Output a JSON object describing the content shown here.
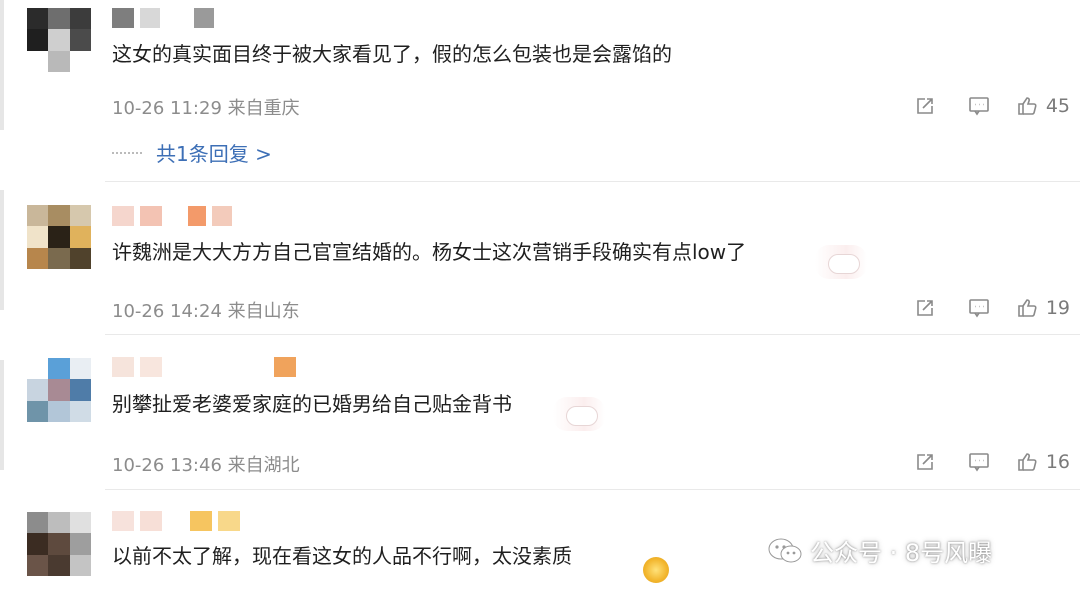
{
  "comments": [
    {
      "text": "这女的真实面目终于被大家看见了，假的怎么包装也是会露馅的",
      "meta": "10-26 11:29 来自重庆",
      "likes": "45",
      "reply_label": "共1条回复 >"
    },
    {
      "text": "许魏洲是大大方方自己官宣结婚的。杨女士这次营销手段确实有点low了",
      "meta": "10-26 14:24 来自山东",
      "likes": "19"
    },
    {
      "text": "别攀扯爱老婆爱家庭的已婚男给自己贴金背书",
      "meta": "10-26 13:46 来自湖北",
      "likes": "16"
    },
    {
      "text": "以前不太了解，现在看这女的人品不行啊，太没素质"
    }
  ],
  "watermark": {
    "text": "公众号 · 8号风曝"
  },
  "icons": {
    "share": "share-icon",
    "comment": "comment-icon",
    "like": "like-icon"
  }
}
